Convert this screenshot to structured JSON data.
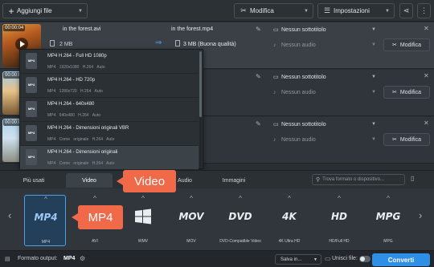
{
  "toolbar": {
    "add_files_label": "Aggiungi file",
    "modify_label": "Modifica",
    "settings_label": "Impostazioni"
  },
  "rows": [
    {
      "duration": "00:00:04",
      "source_name": "in the forest.avi",
      "source_size": "2 MB",
      "output_name": "in the forest.mp4",
      "output_size": "3 MB (Buona qualità)",
      "subtitle": "Nessun sottotitolo",
      "audio": "Nessun audio",
      "modify_label": "Modifica"
    },
    {
      "duration": "00:00:0",
      "subtitle": "Nessun sottotitolo",
      "audio": "Nessun audio",
      "modify_label": "Modifica"
    },
    {
      "duration": "00:00:0",
      "subtitle": "Nessun sottotitolo",
      "audio": "Nessun audio",
      "modify_label": "Modifica"
    }
  ],
  "format_dropdown": {
    "items": [
      {
        "title": "MP4 H.264 - Full HD 1080p",
        "specs": "MP4   1920x1080   H.264   Auto"
      },
      {
        "title": "MP4 H.264 - HD 720p",
        "specs": "MP4   1280x720   H.264   Auto"
      },
      {
        "title": "MP4 H.264 - 640x480",
        "specs": "MP4   640x480   H.264   Auto"
      },
      {
        "title": "MP4 H.264 - Dimensioni originali VBR",
        "specs": "MP4   Come originale   H.264   Auto"
      },
      {
        "title": "MP4 H.264 - Dimensioni originali",
        "specs": "MP4   Come originale   H.264   Auto"
      }
    ]
  },
  "tabs": {
    "most_used": "Più usati",
    "video": "Video",
    "audio": "Audio",
    "images": "Immagini"
  },
  "search": {
    "placeholder": "Trova formato o dispositivo..."
  },
  "formats": [
    {
      "logo": "MP4",
      "label": "MP4"
    },
    {
      "logo": "",
      "label": "AVI"
    },
    {
      "logo": "",
      "label": "WMV"
    },
    {
      "logo": "MOV",
      "label": "MOV"
    },
    {
      "logo": "DVD",
      "label": "DVD-Compatible Video"
    },
    {
      "logo": "4K",
      "label": "4K Ultra HD"
    },
    {
      "logo": "HD",
      "label": "HD/Full HD"
    },
    {
      "logo": "MPG",
      "label": "MPG"
    }
  ],
  "statusbar": {
    "output_format_label": "Formato output:",
    "output_format_value": "MP4",
    "save_in_label": "Salva in...",
    "merge_label": "Unisci file:",
    "convert_label": "Converti"
  },
  "callouts": {
    "video": "Video",
    "mp4": "MP4"
  },
  "colors": {
    "accent": "#2f8fe6",
    "callout": "#f06a4a"
  }
}
